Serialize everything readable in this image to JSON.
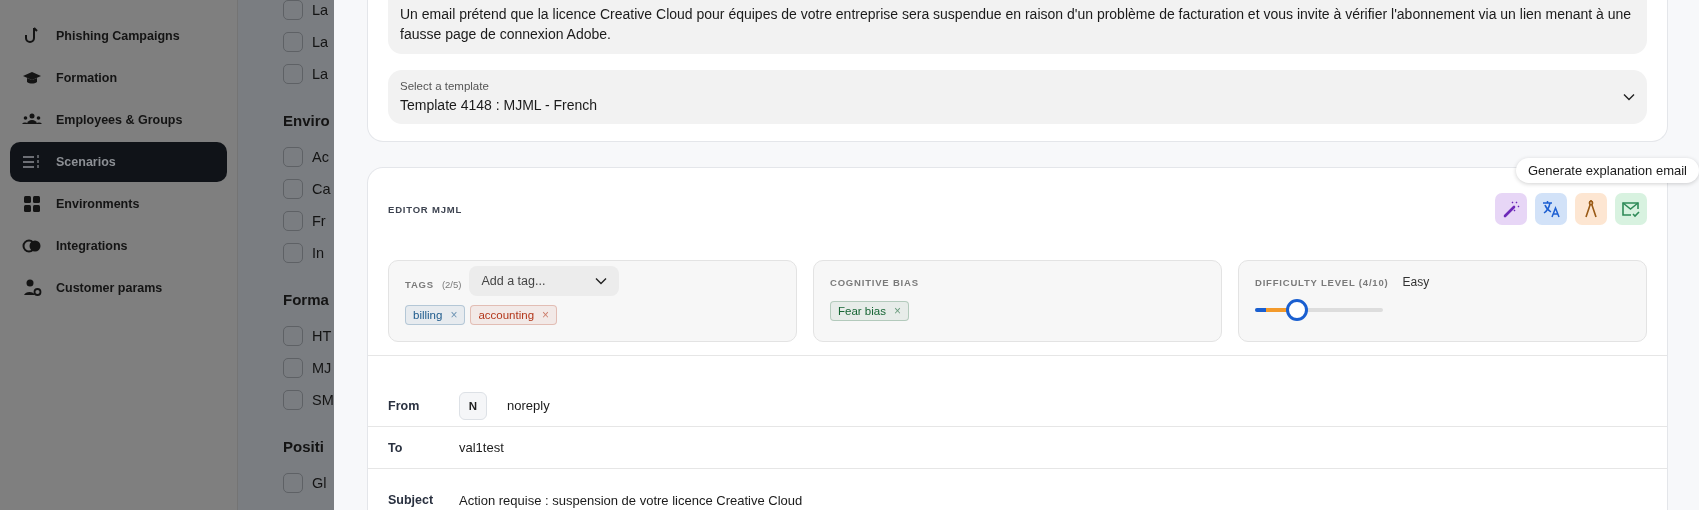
{
  "sidebar": {
    "items": [
      {
        "label": "Phishing Campaigns",
        "selected": false
      },
      {
        "label": "Formation",
        "selected": false
      },
      {
        "label": "Employees & Groups",
        "selected": false
      },
      {
        "label": "Scenarios",
        "selected": true
      },
      {
        "label": "Environments",
        "selected": false
      },
      {
        "label": "Integrations",
        "selected": false
      },
      {
        "label": "Customer params",
        "selected": false
      }
    ]
  },
  "filters": {
    "items": [
      {
        "kind": "checkbox",
        "label": "La",
        "checked": false
      },
      {
        "kind": "checkbox",
        "label": "La",
        "checked": false
      },
      {
        "kind": "checkbox",
        "label": "La",
        "checked": false
      },
      {
        "kind": "heading",
        "label": "Enviro"
      },
      {
        "kind": "checkbox",
        "label": "Ac",
        "checked": false
      },
      {
        "kind": "checkbox",
        "label": "Ca",
        "checked": false
      },
      {
        "kind": "checkbox",
        "label": "Fr",
        "checked": false
      },
      {
        "kind": "checkbox",
        "label": "In",
        "checked": false
      },
      {
        "kind": "heading",
        "label": "Forma"
      },
      {
        "kind": "checkbox",
        "label": "HT",
        "checked": false
      },
      {
        "kind": "checkbox",
        "label": "MJ",
        "checked": false
      },
      {
        "kind": "checkbox",
        "label": "SM",
        "checked": false
      },
      {
        "kind": "heading",
        "label": "Positi"
      },
      {
        "kind": "checkbox",
        "label": "Gl",
        "checked": false
      }
    ]
  },
  "scenario": {
    "description": "Un email prétend que la licence Creative Cloud pour équipes de votre entreprise sera suspendue en raison d'un problème de facturation et vous invite à vérifier l'abonnement via un lien menant à une fausse page de connexion Adobe.",
    "template": {
      "label": "Select a template",
      "value": "Template 4148 : MJML - French"
    }
  },
  "editor": {
    "title": "EDITOR MJML",
    "tooltip": "Generate explanation email",
    "tags": {
      "label": "TAGS",
      "count": "(2/5)",
      "placeholder": "Add a tag...",
      "items": [
        {
          "label": "billing",
          "color": "#1d5a8c",
          "remove": "×"
        },
        {
          "label": "accounting",
          "color": "#b3361a",
          "remove": "×"
        }
      ]
    },
    "cognitive_bias": {
      "label": "COGNITIVE BIAS",
      "items": [
        {
          "label": "Fear bias",
          "color": "#166534",
          "remove": "×"
        }
      ]
    },
    "difficulty": {
      "label": "DIFFICULTY LEVEL (4/10)",
      "value": "Easy",
      "level": 0.33
    },
    "fields": [
      {
        "kind": "sender",
        "label": "From",
        "avatar": "N",
        "value": "noreply"
      },
      {
        "kind": "plain",
        "label": "To",
        "value": "val1test"
      },
      {
        "kind": "plain",
        "label": "Subject",
        "value": "Action requise : suspension de votre licence Creative Cloud"
      }
    ]
  }
}
